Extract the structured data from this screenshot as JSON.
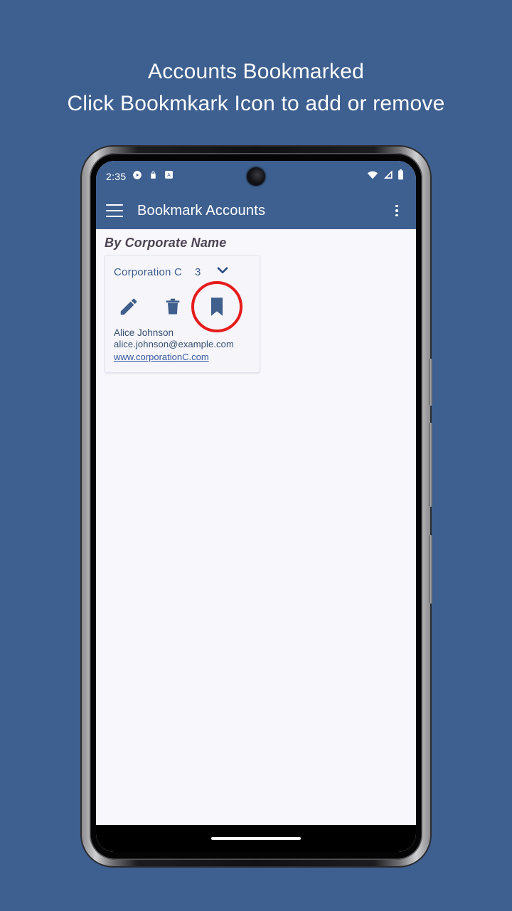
{
  "promo": {
    "line1": "Accounts Bookmarked",
    "line2": "Click Bookmkark Icon to add or remove"
  },
  "colors": {
    "background_blue": "#3e6090",
    "app_bar_blue": "#3e6090",
    "screen_background": "#f8f7fc",
    "card_background": "#f6f6fa",
    "highlight_red": "#e51c1c",
    "icon_blue": "#3f5f8c",
    "link_blue": "#3557a0",
    "section_title": "#4c4352"
  },
  "phone": {
    "status_bar": {
      "time": "2:35",
      "left_icons": [
        "play-circle-icon",
        "shopping-bag-icon",
        "letter-a-icon"
      ],
      "right_icons": [
        "wifi-icon",
        "cellular-signal-icon",
        "battery-icon"
      ],
      "camera": "front-camera-punch-hole"
    },
    "app_bar": {
      "menu_icon": "hamburger-menu-icon",
      "title": "Bookmark Accounts",
      "overflow_icon": "kebab-menu-icon"
    },
    "content": {
      "section_title": "By Corporate Name",
      "cards": [
        {
          "corporate_name": "Corporation C",
          "count": "3",
          "expand_icon": "chevron-down-icon",
          "actions": [
            {
              "name": "edit-icon",
              "label": "Edit"
            },
            {
              "name": "delete-icon",
              "label": "Delete"
            },
            {
              "name": "bookmark-icon",
              "label": "Bookmark",
              "active": true,
              "highlighted": true
            }
          ],
          "contact_name": "Alice Johnson",
          "contact_email": "alice.johnson@example.com",
          "contact_website": "www.corporationC.com"
        }
      ]
    },
    "nav_bar": {
      "gesture_pill": "home-gesture-pill"
    }
  }
}
